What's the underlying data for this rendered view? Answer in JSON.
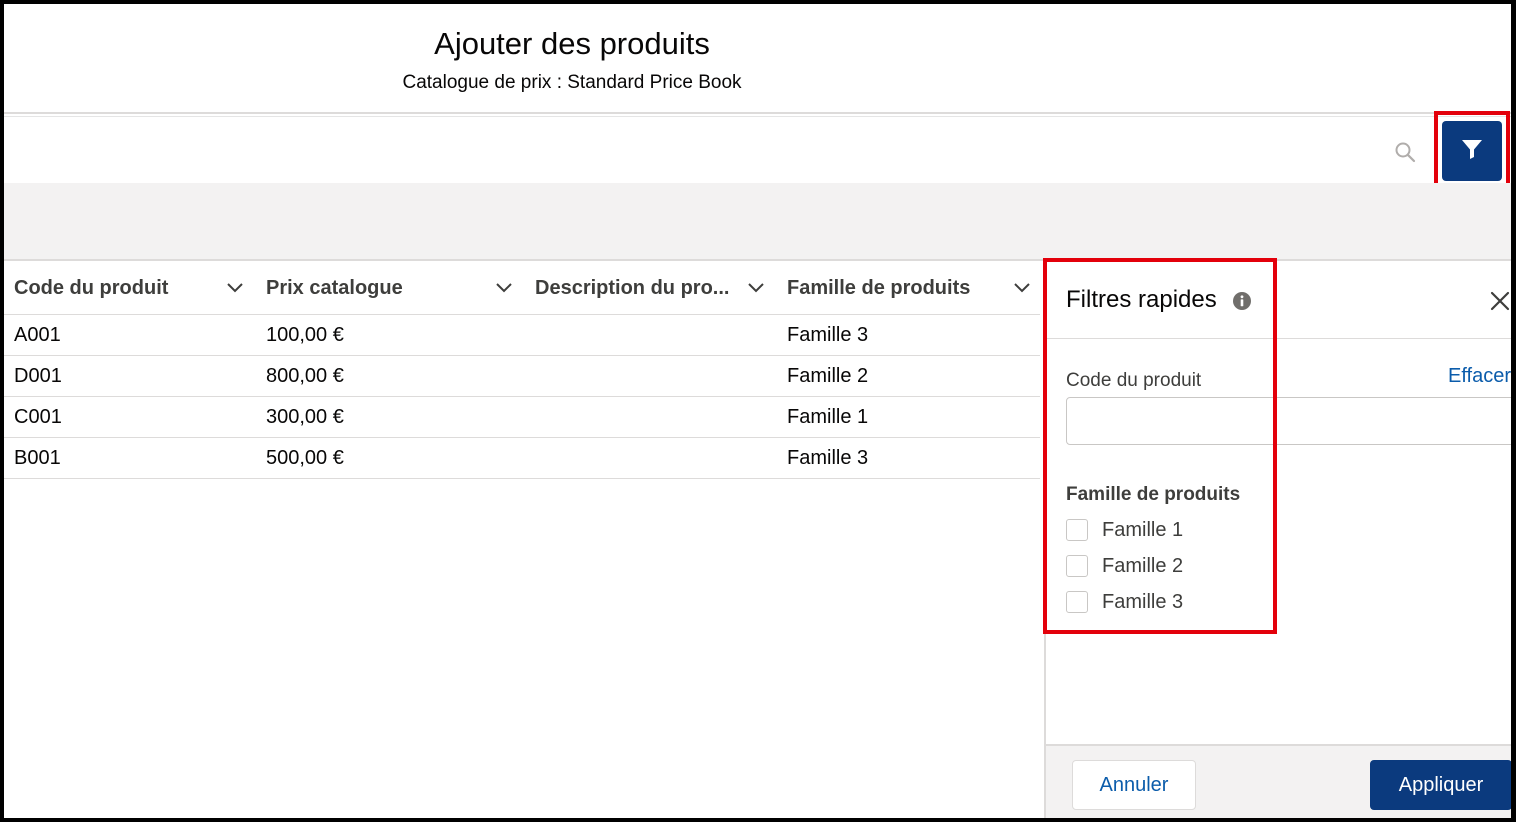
{
  "header": {
    "title": "Ajouter des produits",
    "subtitle": "Catalogue de prix : Standard Price Book"
  },
  "search": {
    "placeholder": "",
    "icon": "search-icon",
    "filter_icon": "filter-icon"
  },
  "table": {
    "columns": [
      {
        "label": "Code du produit"
      },
      {
        "label": "Prix catalogue"
      },
      {
        "label": "Description du pro..."
      },
      {
        "label": "Famille de produits"
      }
    ],
    "rows": [
      {
        "code": "A001",
        "price": "100,00 €",
        "description": "",
        "family": "Famille 3"
      },
      {
        "code": "D001",
        "price": "800,00 €",
        "description": "",
        "family": "Famille 2"
      },
      {
        "code": "C001",
        "price": "300,00 €",
        "description": "",
        "family": "Famille 1"
      },
      {
        "code": "B001",
        "price": "500,00 €",
        "description": "",
        "family": "Famille 3"
      }
    ]
  },
  "filters": {
    "title": "Filtres rapides",
    "code_label": "Code du produit",
    "clear_label": "Effacer",
    "code_value": "",
    "family_label": "Famille de produits",
    "options": [
      {
        "label": "Famille 1",
        "checked": false
      },
      {
        "label": "Famille 2",
        "checked": false
      },
      {
        "label": "Famille 3",
        "checked": false
      }
    ],
    "cancel_label": "Annuler",
    "apply_label": "Appliquer"
  },
  "colors": {
    "brand": "#0b3a7e",
    "link": "#0b5cab",
    "highlight": "#e3000b"
  }
}
